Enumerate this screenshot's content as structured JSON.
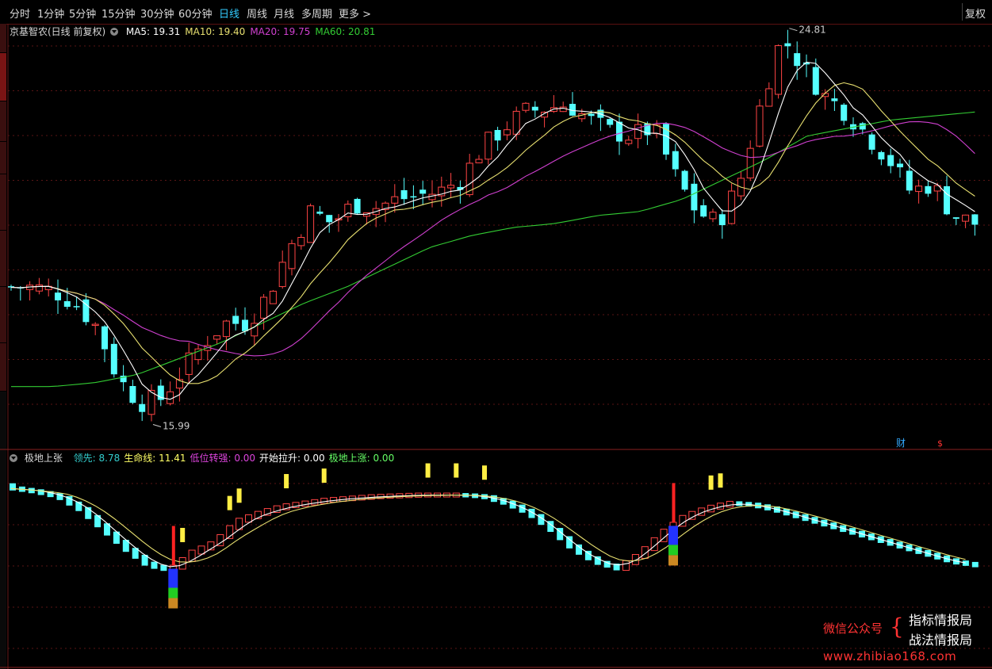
{
  "toolbar": {
    "periods": [
      "分时",
      "1分钟",
      "5分钟",
      "15分钟",
      "30分钟",
      "60分钟",
      "日线",
      "周线",
      "月线",
      "多周期",
      "更多 >"
    ],
    "active": "日线",
    "restore_label": "复权"
  },
  "main_chart": {
    "stock_title": "京基智农(日线 前复权)",
    "ma": [
      {
        "label": "MA5: 19.31",
        "color": "#ffffff"
      },
      {
        "label": "MA10: 19.40",
        "color": "#e8e070"
      },
      {
        "label": "MA20: 19.75",
        "color": "#d040d0"
      },
      {
        "label": "MA60: 20.81",
        "color": "#33cc33"
      }
    ],
    "high_label": "24.81",
    "low_label": "15.99",
    "marker_cai": "财",
    "marker_red": "$"
  },
  "sub_chart": {
    "name": "极地上张",
    "items": [
      {
        "label": "领先: 8.78",
        "color": "#33cccc"
      },
      {
        "label": "生命线: 11.41",
        "color": "#ffff66"
      },
      {
        "label": "低位转强: 0.00",
        "color": "#dd44dd"
      },
      {
        "label": "开始拉升: 0.00",
        "color": "#ffffff"
      },
      {
        "label": "极地上涨: 0.00",
        "color": "#66ff66"
      }
    ]
  },
  "watermark": {
    "wechat": "微信公众号",
    "line1": "指标情报局",
    "line2": "战法情报局",
    "url": "www.zhibiao168.com"
  },
  "colors": {
    "up": "#ff4444",
    "down": "#55ffff",
    "ma5": "#ffffff",
    "ma10": "#e8e070",
    "ma20": "#d040d0",
    "ma60": "#33cc33"
  },
  "chart_data": {
    "type": "candlestick",
    "ylim": [
      15.5,
      25.5
    ],
    "close_anchors": [
      19.4,
      19.4,
      19.3,
      19.0,
      18.4,
      17.1,
      16.5,
      16.6,
      17.3,
      18.0,
      18.5,
      18.5,
      19.2,
      20.4,
      21.3,
      21.0,
      21.5,
      21.4,
      21.6,
      21.7,
      21.8,
      22.1,
      22.9,
      23.4,
      23.8,
      23.9,
      24.0,
      23.6,
      23.3,
      23.2,
      23.4,
      22.2,
      21.3,
      21.0,
      22.0,
      24.0,
      25.7,
      24.9,
      24.2,
      23.8,
      23.2,
      22.6,
      21.8,
      22.0,
      21.2,
      21.0
    ],
    "ma60_anchors": [
      16.9,
      16.9,
      17.0,
      17.2,
      17.6,
      18.0,
      18.5,
      19.0,
      19.4,
      19.9,
      20.4,
      20.7,
      20.9,
      21.0,
      21.2,
      21.3,
      21.6,
      22.1,
      22.6,
      23.2,
      23.4,
      23.6,
      23.7,
      23.8
    ],
    "sub_ylim": [
      0,
      100
    ],
    "sub_anchors": [
      95,
      93,
      90,
      82,
      70,
      58,
      48,
      45,
      56,
      62,
      75,
      80,
      84,
      86,
      88,
      89,
      90,
      90.5,
      91,
      91,
      91,
      90,
      86,
      80,
      70,
      58,
      50,
      46,
      55,
      68,
      78,
      83,
      86,
      85,
      82,
      78,
      74,
      70,
      66,
      62,
      58,
      54,
      50,
      48
    ],
    "signal_positions_pct": [
      0.162,
      0.69
    ],
    "yellow_bar_positions_pct": [
      0.18,
      0.23,
      0.24,
      0.285,
      0.325,
      0.43,
      0.46,
      0.49,
      0.725,
      0.735
    ]
  }
}
